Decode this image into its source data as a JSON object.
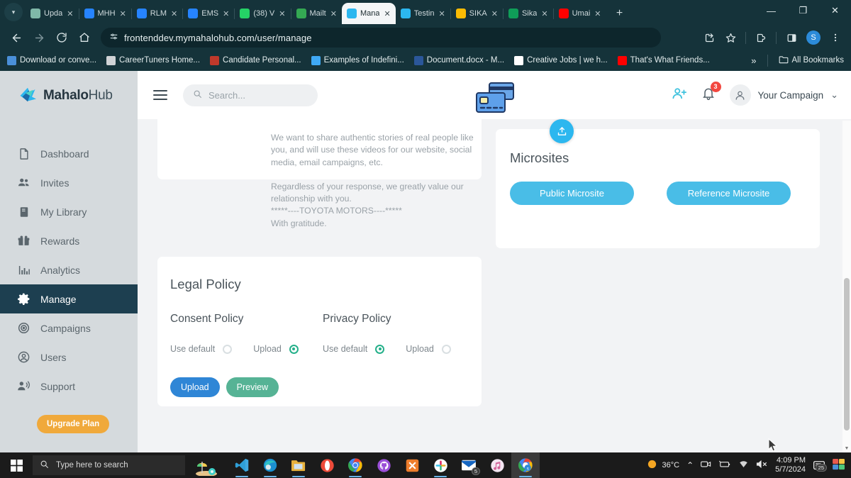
{
  "browser": {
    "tabs": [
      {
        "label": "Upda",
        "favicon": "globe-icon",
        "color": "#7fb8a8",
        "active": false
      },
      {
        "label": "MHH",
        "favicon": "jira-icon",
        "color": "#2684ff",
        "active": false
      },
      {
        "label": "RLM",
        "favicon": "jira-icon",
        "color": "#2684ff",
        "active": false
      },
      {
        "label": "EMS",
        "favicon": "jira-icon",
        "color": "#2684ff",
        "active": false
      },
      {
        "label": "(38) V",
        "favicon": "whatsapp-icon",
        "color": "#25d366",
        "active": false
      },
      {
        "label": "Mailt",
        "favicon": "gmail-icon",
        "color": "#34a853",
        "active": false
      },
      {
        "label": "Mana",
        "favicon": "mahalohub-icon",
        "color": "#2cb7ef",
        "active": true
      },
      {
        "label": "Testin",
        "favicon": "mahalohub-icon",
        "color": "#2cb7ef",
        "active": false
      },
      {
        "label": "SIKA",
        "favicon": "google-drive-icon",
        "color": "#fbbc04",
        "active": false
      },
      {
        "label": "Sika ",
        "favicon": "google-sheets-icon",
        "color": "#0f9d58",
        "active": false
      },
      {
        "label": "Umai",
        "favicon": "youtube-icon",
        "color": "#ff0000",
        "active": false
      }
    ],
    "new_tab_label": "+",
    "close_glyph": "✕",
    "window_controls": {
      "minimize": "—",
      "maximize": "❐",
      "close": "✕"
    },
    "nav": {
      "back": "←",
      "forward": "→",
      "reload": "↻",
      "home": "⌂"
    },
    "omnibox": {
      "url": "frontenddev.mymahalohub.com/user/manage",
      "site_icon": "site-settings-icon"
    },
    "toolbar_right": {
      "install_icon": "install-app-icon",
      "bookmark_icon": "star-icon",
      "extensions_icon": "extensions-icon",
      "sidepanel_icon": "side-panel-icon",
      "profile_initial": "S",
      "menu_icon": "kebab-menu-icon"
    },
    "bookmarks": [
      {
        "label": "Download or conve...",
        "color": "#4a90d9"
      },
      {
        "label": "CareerTuners Home...",
        "color": "#d0d3d6"
      },
      {
        "label": "Candidate Personal...",
        "color": "#c0392b"
      },
      {
        "label": "Examples of Indefini...",
        "color": "#3fa9f5"
      },
      {
        "label": "Document.docx - M...",
        "color": "#2b579a"
      },
      {
        "label": "Creative Jobs | we h...",
        "color": "#ffffff"
      },
      {
        "label": "That's What Friends...",
        "color": "#ff0000"
      }
    ],
    "bookmarks_overflow": "»",
    "all_bookmarks_label": "All Bookmarks"
  },
  "app": {
    "logo": {
      "brand_bold": "Mahalo",
      "brand_light": "Hub"
    },
    "sidebar": {
      "items": [
        {
          "label": "Dashboard",
          "icon": "document-icon",
          "active": false
        },
        {
          "label": "Invites",
          "icon": "people-icon",
          "active": false
        },
        {
          "label": "My Library",
          "icon": "book-icon",
          "active": false
        },
        {
          "label": "Rewards",
          "icon": "gift-icon",
          "active": false
        },
        {
          "label": "Analytics",
          "icon": "bar-chart-icon",
          "active": false
        },
        {
          "label": "Manage",
          "icon": "gear-icon",
          "active": true
        },
        {
          "label": "Campaigns",
          "icon": "target-icon",
          "active": false
        },
        {
          "label": "Users",
          "icon": "user-circle-icon",
          "active": false
        },
        {
          "label": "Support",
          "icon": "support-agent-icon",
          "active": false
        }
      ],
      "upgrade_label": "Upgrade Plan"
    },
    "header": {
      "menu_icon": "hamburger-icon",
      "search_placeholder": "Search...",
      "search_value": "",
      "search_icon": "search-icon",
      "brand_card_icon": "credit-cards-icon",
      "add_user_icon": "add-user-icon",
      "bell_icon": "bell-icon",
      "notification_count": "3",
      "account_icon": "user-avatar-icon",
      "campaign_label": "Your Campaign",
      "chevron": "⌄"
    },
    "upload_fab_icon": "upload-icon",
    "message_card": {
      "paragraph1": "We want to share authentic stories of real people like you, and will use these videos for our website, social media, email campaigns, etc.",
      "paragraph2": "Regardless of your response, we greatly value our relationship with you.",
      "signature_line": "*****----TOYOTA MOTORS----*****",
      "closing": "With gratitude."
    },
    "microsites": {
      "title": "Microsites",
      "buttons": [
        {
          "label": "Public Microsite"
        },
        {
          "label": "Reference Microsite"
        }
      ]
    },
    "legal_policy": {
      "title": "Legal Policy",
      "columns": [
        {
          "title": "Consent Policy",
          "options": [
            {
              "label": "Use default",
              "selected": false
            },
            {
              "label": "Upload",
              "selected": true
            }
          ]
        },
        {
          "title": "Privacy Policy",
          "options": [
            {
              "label": "Use default",
              "selected": true
            },
            {
              "label": "Upload",
              "selected": false
            }
          ]
        }
      ],
      "upload_button": "Upload",
      "preview_button": "Preview"
    },
    "colors": {
      "accent_blue": "#2cb7ef",
      "pill_blue": "#49bde7",
      "sidebar_active": "#1d3f50",
      "upgrade_orange": "#f0a93b",
      "radio_green": "#25b08a",
      "preview_green": "#56b395",
      "upload_blue": "#2f86d6",
      "badge_red": "#f2473f"
    }
  },
  "taskbar": {
    "start_icon": "windows-start-icon",
    "search_placeholder": "Type here to search",
    "search_icon": "search-icon",
    "weather_icon": "sunny-icon",
    "temperature": "36°C",
    "apps": [
      {
        "name": "vscode-icon",
        "open": true
      },
      {
        "name": "microsoft-edge-icon",
        "open": true
      },
      {
        "name": "file-explorer-icon",
        "open": true
      },
      {
        "name": "opera-icon",
        "open": false
      },
      {
        "name": "google-chrome-icon",
        "open": true
      },
      {
        "name": "github-desktop-icon",
        "open": false
      },
      {
        "name": "xampp-icon",
        "open": false
      },
      {
        "name": "slack-icon",
        "open": true
      },
      {
        "name": "mail-icon",
        "open": false,
        "badge": "5"
      },
      {
        "name": "itunes-icon",
        "open": false
      },
      {
        "name": "chrome-active-icon",
        "open": true
      }
    ],
    "tray": {
      "chevron": "⌃",
      "camera_icon": "camera-icon",
      "battery_icon": "battery-icon",
      "wifi_icon": "wifi-icon",
      "volume_icon": "volume-muted-icon",
      "time": "4:09 PM",
      "date": "5/7/2024",
      "notifications_icon": "notification-icon",
      "notifications_count": "25",
      "widget_icon": "widgets-icon"
    }
  }
}
